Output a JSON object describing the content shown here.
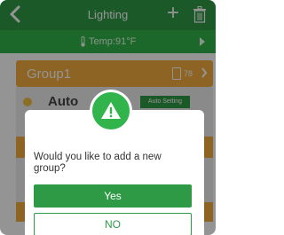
{
  "header": {
    "title": "Lighting",
    "plus_label": "+"
  },
  "temp_bar": {
    "text": "Temp:91°F"
  },
  "group": {
    "name": "Group1",
    "count": "78",
    "mode": "Auto",
    "setting_label": "Auto Setting"
  },
  "dialog": {
    "message": "Would you like to add a new group?",
    "yes_label": "Yes",
    "no_label": "NO"
  },
  "colors": {
    "header_green": "#2f9a46",
    "tempbar_green": "#31b44b",
    "group_orange": "#f5ad3f",
    "badge_green": "#31b44b"
  }
}
